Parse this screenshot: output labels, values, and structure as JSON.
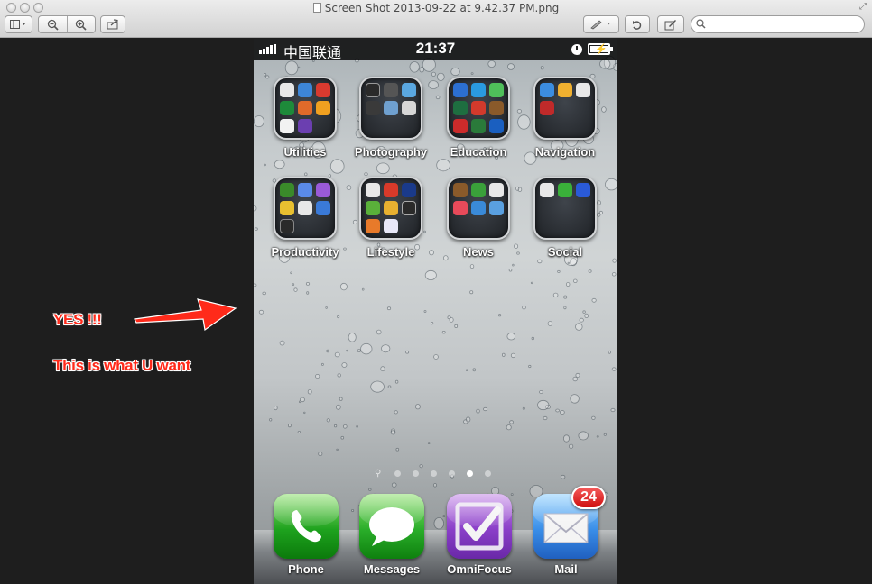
{
  "window": {
    "title": "Screen Shot 2013-09-22 at 9.42.37 PM.png",
    "search_placeholder": "",
    "toolbar": {
      "sidebar_icon": "sidebar-icon",
      "zoom_out_icon": "zoom-out-icon",
      "zoom_in_icon": "zoom-in-icon",
      "share_icon": "share-icon",
      "annotate_icon": "annotate-pen-icon",
      "rotate_icon": "rotate-icon",
      "edit_icon": "edit-icon"
    }
  },
  "phone": {
    "status_bar": {
      "carrier": "中国联通",
      "time": "21:37"
    },
    "folders": [
      {
        "label": "Utilities"
      },
      {
        "label": "Photography"
      },
      {
        "label": "Education"
      },
      {
        "label": "Navigation"
      },
      {
        "label": "Productivity"
      },
      {
        "label": "Lifestyle"
      },
      {
        "label": "News"
      },
      {
        "label": "Social"
      }
    ],
    "page_dots": {
      "count": 6,
      "active_index": 5
    },
    "dock": [
      {
        "label": "Phone",
        "icon": "phone-icon"
      },
      {
        "label": "Messages",
        "icon": "messages-icon"
      },
      {
        "label": "OmniFocus",
        "icon": "omnifocus-check-icon"
      },
      {
        "label": "Mail",
        "icon": "mail-icon",
        "badge": "24"
      }
    ]
  },
  "annotations": {
    "line1": "YES !!!",
    "line2": "This is what U want"
  },
  "colors": {
    "annotation_red": "#ff2a1a",
    "badge_red": "#cf0f0f",
    "desktop_bg": "#1e1e1e"
  }
}
